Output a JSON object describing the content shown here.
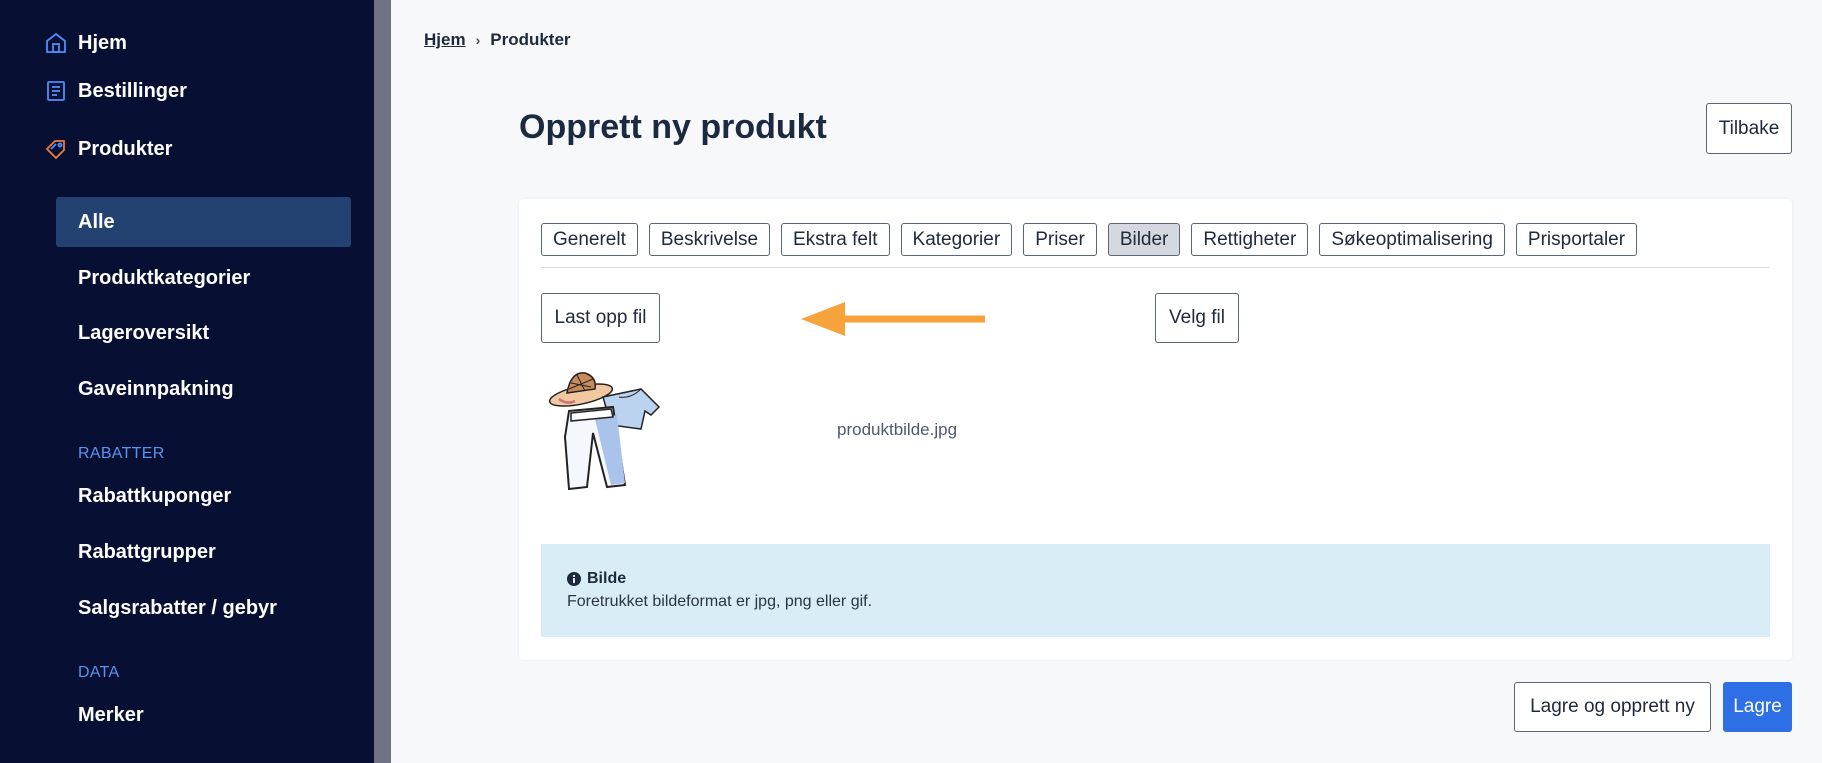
{
  "sidebar": {
    "nav": [
      {
        "label": "Hjem",
        "icon": "home-icon"
      },
      {
        "label": "Bestillinger",
        "icon": "orders-icon"
      },
      {
        "label": "Produkter",
        "icon": "tag-icon"
      }
    ],
    "sub_items": [
      {
        "label": "Alle"
      },
      {
        "label": "Produktkategorier"
      },
      {
        "label": "Lageroversikt"
      },
      {
        "label": "Gaveinnpakning"
      }
    ],
    "section_rabatter": "RABATTER",
    "rabatter_items": [
      {
        "label": "Rabattkuponger"
      },
      {
        "label": "Rabattgrupper"
      },
      {
        "label": "Salgsrabatter / gebyr"
      }
    ],
    "section_data": "DATA",
    "data_items": [
      {
        "label": "Merker"
      }
    ]
  },
  "breadcrumb": {
    "home": "Hjem",
    "separator": "›",
    "current": "Produkter"
  },
  "page": {
    "title": "Opprett ny produkt",
    "back_label": "Tilbake"
  },
  "tabs": [
    {
      "label": "Generelt"
    },
    {
      "label": "Beskrivelse"
    },
    {
      "label": "Ekstra felt"
    },
    {
      "label": "Kategorier"
    },
    {
      "label": "Priser"
    },
    {
      "label": "Bilder"
    },
    {
      "label": "Rettigheter"
    },
    {
      "label": "Søkeoptimalisering"
    },
    {
      "label": "Prisportaler"
    }
  ],
  "active_tab": "Bilder",
  "upload": {
    "upload_label": "Last opp fil",
    "choose_label": "Velg fil",
    "filename": "produktbilde.jpg"
  },
  "info": {
    "title": "Bilde",
    "text": "Foretrukket bildeformat er jpg, png eller gif."
  },
  "footer": {
    "save_new_label": "Lagre og opprett ny",
    "save_label": "Lagre"
  },
  "colors": {
    "sidebar_bg": "#070f33",
    "active_item_bg": "#234272",
    "accent": "#2f6fe6",
    "section_head": "#5a93f0",
    "info_bg": "#d8edf5",
    "arrow": "#f5a33a"
  }
}
